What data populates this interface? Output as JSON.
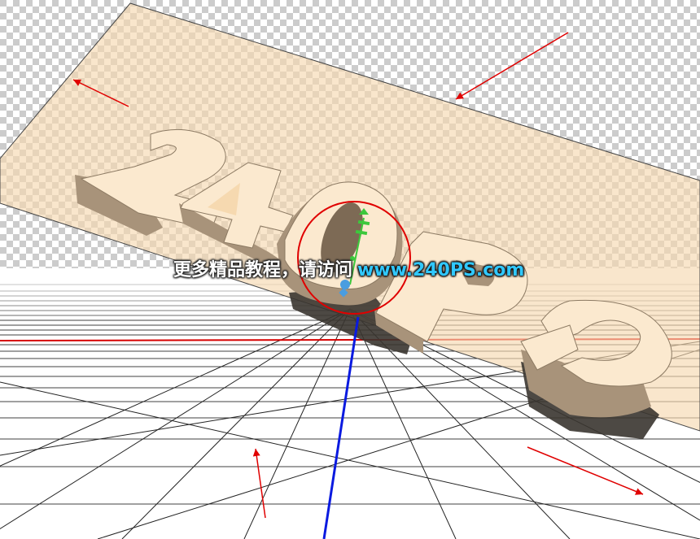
{
  "scene": {
    "text_3d": "240PS",
    "colors": {
      "plane_fill": "#f6d9b0",
      "letter_face": "#fbe9cf",
      "letter_side": "#a8937a",
      "letter_shadow": "#3a3530",
      "ground_line": "#d60000",
      "axis_z": "#0a1ae0",
      "axis_y": "#3cc83c",
      "gizmo_handle": "#4a9de0",
      "annotation_circle": "#e00000",
      "arrow": "#e00000"
    },
    "icons": {
      "rotate_gizmo": "rotate-gizmo-icon",
      "move_handle": "move-handle-icon"
    }
  },
  "watermark": {
    "chinese": "更多精品教程，请访问",
    "url": "www.240PS.com"
  }
}
